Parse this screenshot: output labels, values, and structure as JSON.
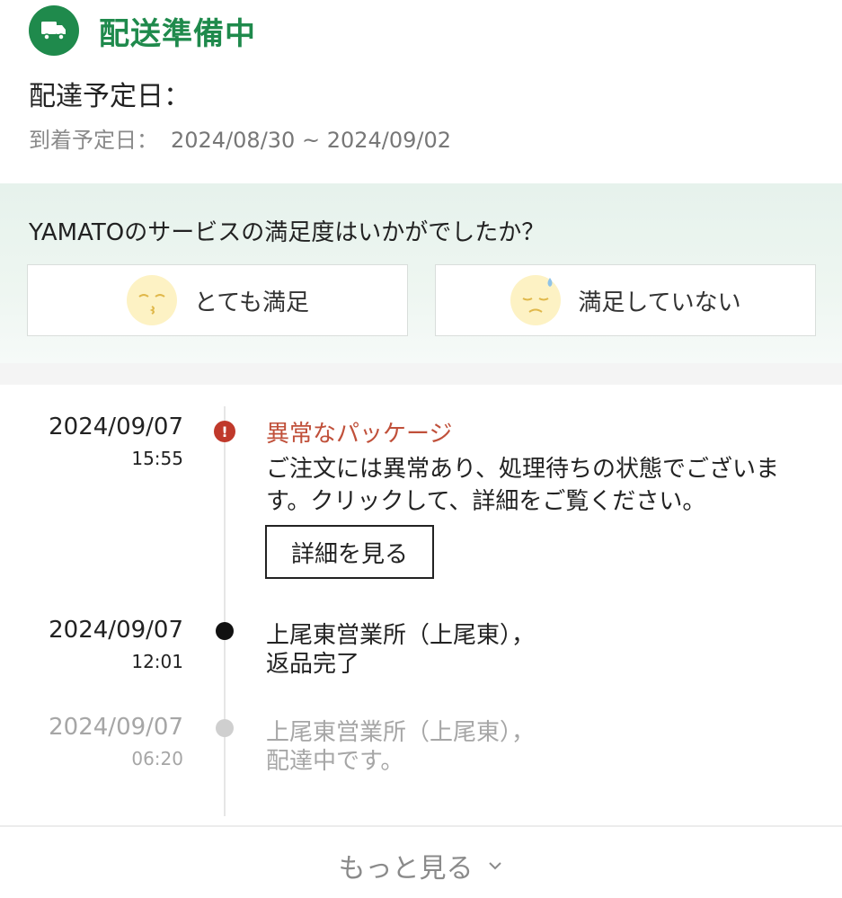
{
  "header": {
    "status_title": "配送準備中",
    "delivery_label": "配達予定日：",
    "arrival_label": "到着予定日：",
    "arrival_range": "2024/08/30 ~ 2024/09/02"
  },
  "survey": {
    "question": "YAMATOのサービスの満足度はいかがでしたか？",
    "option_satisfied": "とても満足",
    "option_unsatisfied": "満足していない"
  },
  "timeline": {
    "events": [
      {
        "date": "2024/09/07",
        "time": "15:55",
        "title": "異常なパッケージ",
        "description": "ご注文には異常あり、処理待ちの状態でございます。クリックして、詳細をご覧ください。",
        "action_label": "詳細を見る"
      },
      {
        "date": "2024/09/07",
        "time": "12:01",
        "line1": "上尾東営業所（上尾東），",
        "line2": "返品完了"
      },
      {
        "date": "2024/09/07",
        "time": "06:20",
        "line1": "上尾東営業所（上尾東），",
        "line2": "配達中です。"
      }
    ]
  },
  "footer": {
    "more_label": "もっと見る"
  },
  "colors": {
    "brand_green": "#1f8a4c",
    "alert_red": "#c0392b"
  }
}
